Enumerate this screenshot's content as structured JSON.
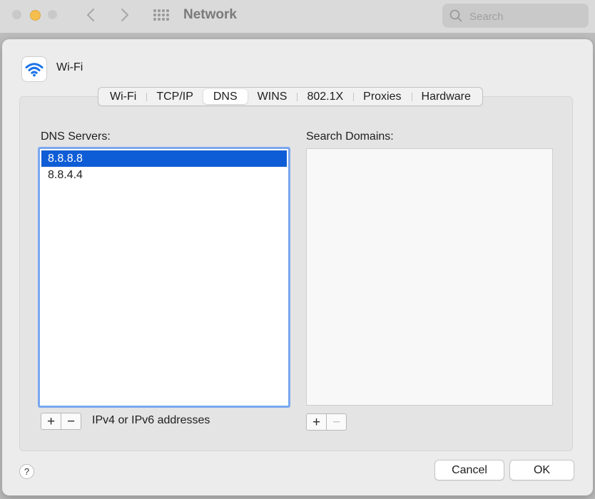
{
  "window": {
    "title": "Network",
    "search_placeholder": "Search"
  },
  "interface": {
    "name": "Wi-Fi",
    "icon": "wifi-icon"
  },
  "tabs": [
    {
      "label": "Wi-Fi",
      "active": false
    },
    {
      "label": "TCP/IP",
      "active": false
    },
    {
      "label": "DNS",
      "active": true
    },
    {
      "label": "WINS",
      "active": false
    },
    {
      "label": "802.1X",
      "active": false
    },
    {
      "label": "Proxies",
      "active": false
    },
    {
      "label": "Hardware",
      "active": false
    }
  ],
  "dns": {
    "label": "DNS Servers:",
    "servers": [
      "8.8.8.8",
      "8.8.4.4"
    ],
    "selected": "8.8.8.8",
    "hint": "IPv4 or IPv6 addresses",
    "add_label": "+",
    "remove_label": "−"
  },
  "search_domains": {
    "label": "Search Domains:",
    "domains": [],
    "add_label": "+",
    "remove_label": "−"
  },
  "footer": {
    "help_label": "?",
    "cancel_label": "Cancel",
    "ok_label": "OK"
  },
  "colors": {
    "selection": "#0f5dd6",
    "focus_ring": "#7aa7f0",
    "wifi_blue": "#1a73e8",
    "minimize_yellow": "#f6be4f"
  }
}
